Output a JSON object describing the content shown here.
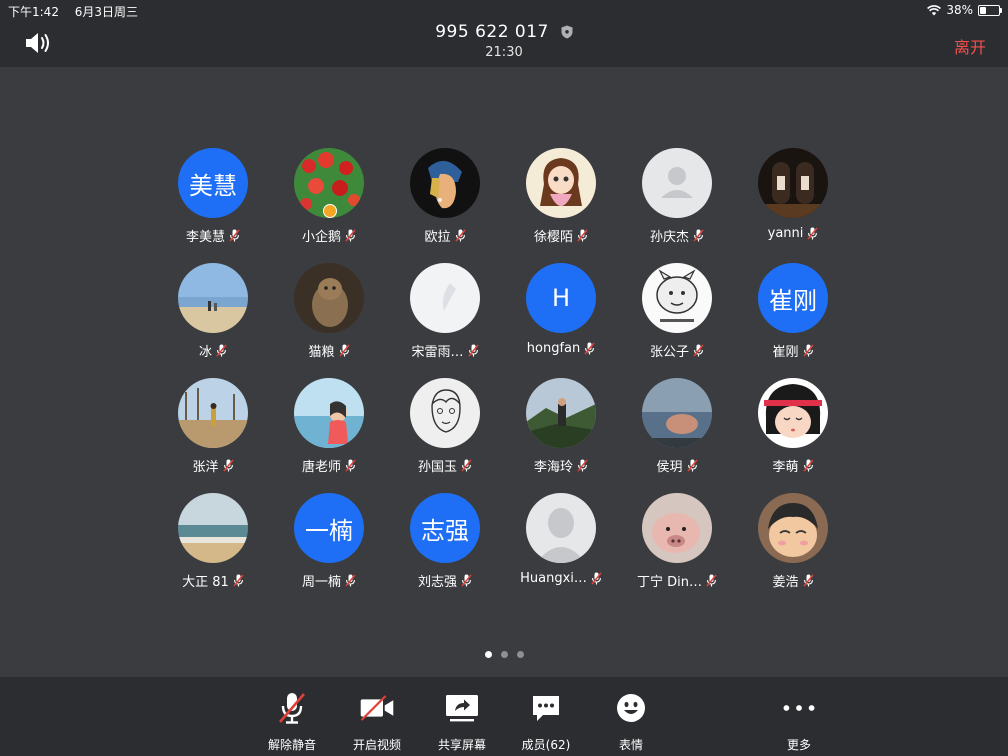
{
  "status": {
    "time": "下午1:42",
    "date": "6月3日周三",
    "battery": "38%",
    "battery_level": 0.38
  },
  "header": {
    "meeting_id": "995 622 017",
    "elapsed": "21:30",
    "leave_label": "离开"
  },
  "participants": [
    {
      "name": "李美慧",
      "avatar_text": "美慧",
      "kind": "blue"
    },
    {
      "name": "小企鹅",
      "kind": "photo",
      "photo": "tulips",
      "host": true
    },
    {
      "name": "欧拉",
      "kind": "photo",
      "photo": "girl-earring"
    },
    {
      "name": "徐樱陌",
      "kind": "photo",
      "photo": "cartoon-girl"
    },
    {
      "name": "孙庆杰",
      "kind": "default"
    },
    {
      "name": "yanni",
      "kind": "photo",
      "photo": "dark-door"
    },
    {
      "name": "冰",
      "kind": "photo",
      "photo": "beach"
    },
    {
      "name": "猫粮",
      "kind": "photo",
      "photo": "cat"
    },
    {
      "name": "宋雷雨…",
      "kind": "photo",
      "photo": "white"
    },
    {
      "name": "hongfan",
      "avatar_text": "H",
      "kind": "blue"
    },
    {
      "name": "张公子",
      "kind": "photo",
      "photo": "meme"
    },
    {
      "name": "崔刚",
      "avatar_text": "崔刚",
      "kind": "blue"
    },
    {
      "name": "张洋",
      "kind": "photo",
      "photo": "trees"
    },
    {
      "name": "唐老师",
      "kind": "photo",
      "photo": "seaside"
    },
    {
      "name": "孙国玉",
      "kind": "photo",
      "photo": "sketch"
    },
    {
      "name": "李海玲",
      "kind": "photo",
      "photo": "mountain"
    },
    {
      "name": "侯玥",
      "kind": "photo",
      "photo": "lake"
    },
    {
      "name": "李萌",
      "kind": "photo",
      "photo": "doll"
    },
    {
      "name": "大正 81",
      "kind": "photo",
      "photo": "shore"
    },
    {
      "name": "周一楠",
      "avatar_text": "一楠",
      "kind": "blue"
    },
    {
      "name": "刘志强",
      "avatar_text": "志强",
      "kind": "blue"
    },
    {
      "name": "Huangxi…",
      "kind": "default"
    },
    {
      "name": "丁宁 Din…",
      "kind": "photo",
      "photo": "pig"
    },
    {
      "name": "姜浩",
      "kind": "photo",
      "photo": "cartoon-boy"
    }
  ],
  "pager": {
    "pages": 3,
    "active": 0
  },
  "toolbar": {
    "unmute_label": "解除静音",
    "video_label": "开启视频",
    "share_label": "共享屏幕",
    "members_label": "成员(62)",
    "emoji_label": "表情",
    "more_label": "更多"
  },
  "colors": {
    "background": "#3a3c40",
    "bar": "#2b2d31",
    "avatar_blue": "#1e6ff5",
    "leave_red": "#f2504b",
    "mute_red": "#e0403a"
  }
}
